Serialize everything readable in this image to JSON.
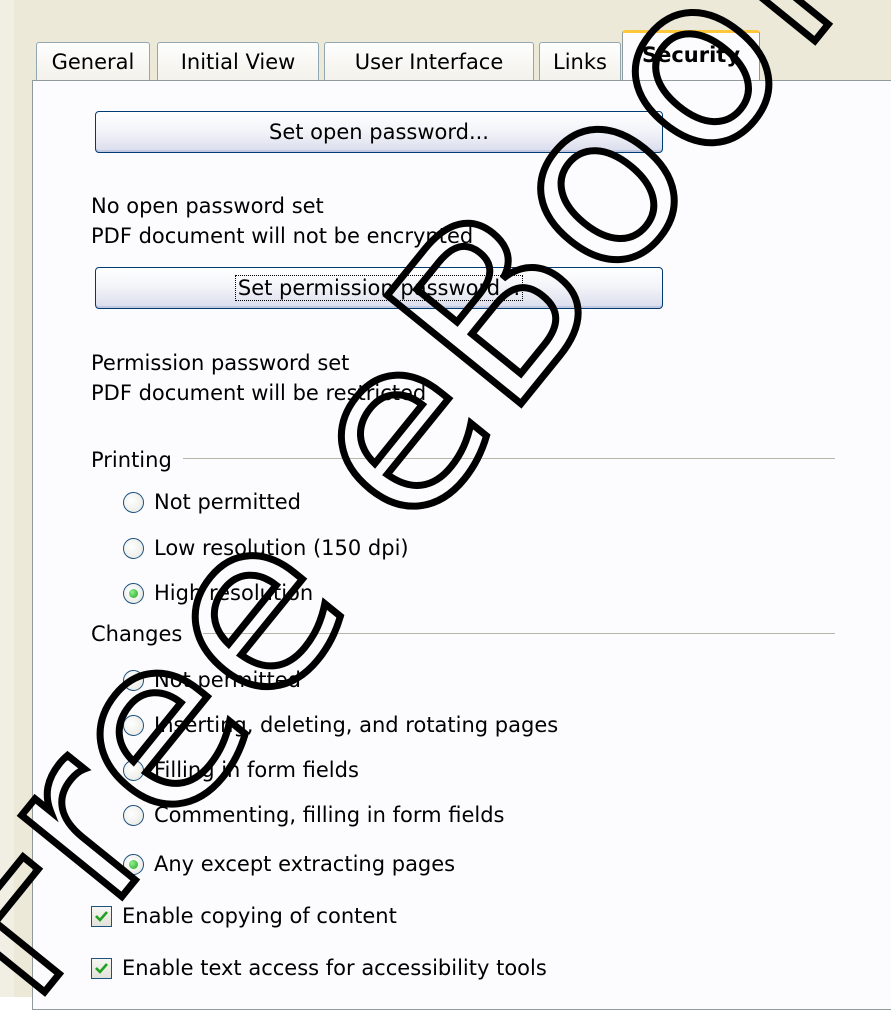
{
  "tabs": [
    {
      "label": "General"
    },
    {
      "label": "Initial View"
    },
    {
      "label": "User Interface"
    },
    {
      "label": "Links"
    },
    {
      "label": "Security"
    }
  ],
  "open_password": {
    "button_label": "Set open password...",
    "status_line1": "No open password set",
    "status_line2": "PDF document will not be encrypted"
  },
  "permission_password": {
    "button_label": "Set permission password...",
    "status_line1": "Permission password set",
    "status_line2": "PDF document will be restricted"
  },
  "printing": {
    "title": "Printing",
    "options": [
      {
        "label": "Not permitted",
        "checked": false
      },
      {
        "label": "Low resolution (150 dpi)",
        "checked": false
      },
      {
        "label": "High resolution",
        "checked": true
      }
    ]
  },
  "changes": {
    "title": "Changes",
    "options": [
      {
        "label": "Not permitted",
        "checked": false
      },
      {
        "label": "Inserting, deleting, and rotating pages",
        "checked": false
      },
      {
        "label": "Filling in form fields",
        "checked": false
      },
      {
        "label": "Commenting, filling in form fields",
        "checked": false
      },
      {
        "label": "Any except extracting pages",
        "checked": true
      }
    ]
  },
  "checkboxes": [
    {
      "label": "Enable copying of content",
      "checked": true
    },
    {
      "label": "Enable text access for accessibility tools",
      "checked": true
    }
  ],
  "watermark": {
    "text": "Free eBook Edition"
  },
  "colors": {
    "tab_highlight": "#ffc83c",
    "check_green": "#21a121",
    "button_border": "#003c74"
  }
}
